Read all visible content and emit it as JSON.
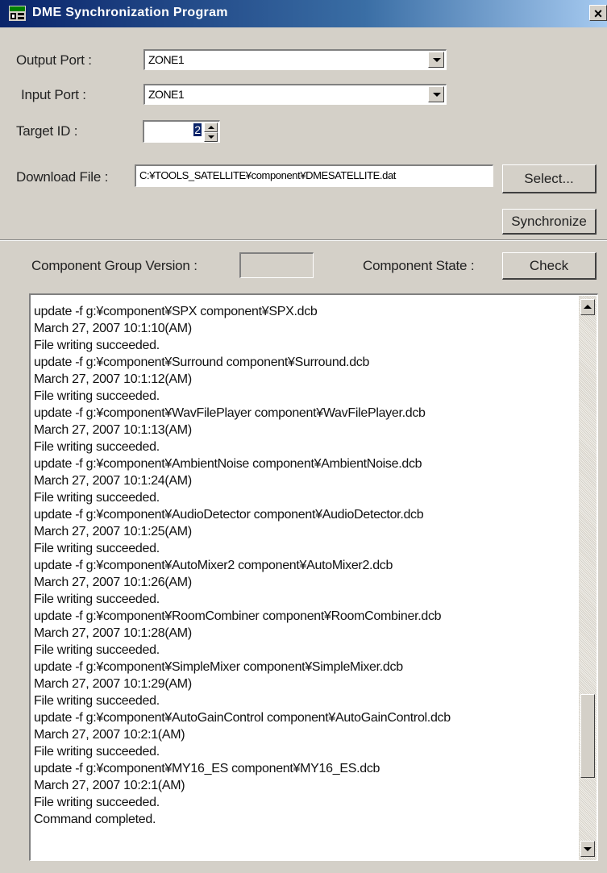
{
  "window": {
    "title": "DME Synchronization Program",
    "close_symbol": "×",
    "icon": "app-window-icon"
  },
  "form": {
    "output_port": {
      "label": "Output Port :",
      "value": "ZONE1"
    },
    "input_port": {
      "label": "Input Port :",
      "value": "ZONE1"
    },
    "target_id": {
      "label": "Target ID :",
      "value": "2"
    },
    "download_file": {
      "label": "Download File :",
      "value": "C:¥TOOLS_SATELLITE¥component¥DMESATELLITE.dat"
    },
    "select_button": "Select...",
    "synchronize_button": "Synchronize"
  },
  "status": {
    "version_label": "Component Group Version :",
    "version_value": "",
    "state_label": "Component State :",
    "check_button": "Check"
  },
  "log": {
    "lines": [
      "update -f g:¥component¥SPX component¥SPX.dcb",
      "March 27, 2007 10:1:10(AM)",
      "File writing succeeded.",
      "update -f g:¥component¥Surround component¥Surround.dcb",
      "March 27, 2007 10:1:12(AM)",
      "File writing succeeded.",
      "update -f g:¥component¥WavFilePlayer component¥WavFilePlayer.dcb",
      "March 27, 2007 10:1:13(AM)",
      "File writing succeeded.",
      "update -f g:¥component¥AmbientNoise component¥AmbientNoise.dcb",
      "March 27, 2007 10:1:24(AM)",
      "File writing succeeded.",
      "update -f g:¥component¥AudioDetector component¥AudioDetector.dcb",
      "March 27, 2007 10:1:25(AM)",
      "File writing succeeded.",
      "update -f g:¥component¥AutoMixer2 component¥AutoMixer2.dcb",
      "March 27, 2007 10:1:26(AM)",
      "File writing succeeded.",
      "update -f g:¥component¥RoomCombiner component¥RoomCombiner.dcb",
      "March 27, 2007 10:1:28(AM)",
      "File writing succeeded.",
      "update -f g:¥component¥SimpleMixer component¥SimpleMixer.dcb",
      "March 27, 2007 10:1:29(AM)",
      "File writing succeeded.",
      "update -f g:¥component¥AutoGainControl component¥AutoGainControl.dcb",
      "March 27, 2007 10:2:1(AM)",
      "File writing succeeded.",
      "update -f g:¥component¥MY16_ES component¥MY16_ES.dcb",
      "March 27, 2007 10:2:1(AM)",
      "File writing succeeded.",
      "Command completed."
    ],
    "scroll_position": 0.86,
    "visible_fraction": 0.16
  },
  "colors": {
    "window_bg": "#d4d0c8",
    "titlebar_start": "#0a246a",
    "titlebar_end": "#a6caf0",
    "selection": "#0a246a"
  }
}
